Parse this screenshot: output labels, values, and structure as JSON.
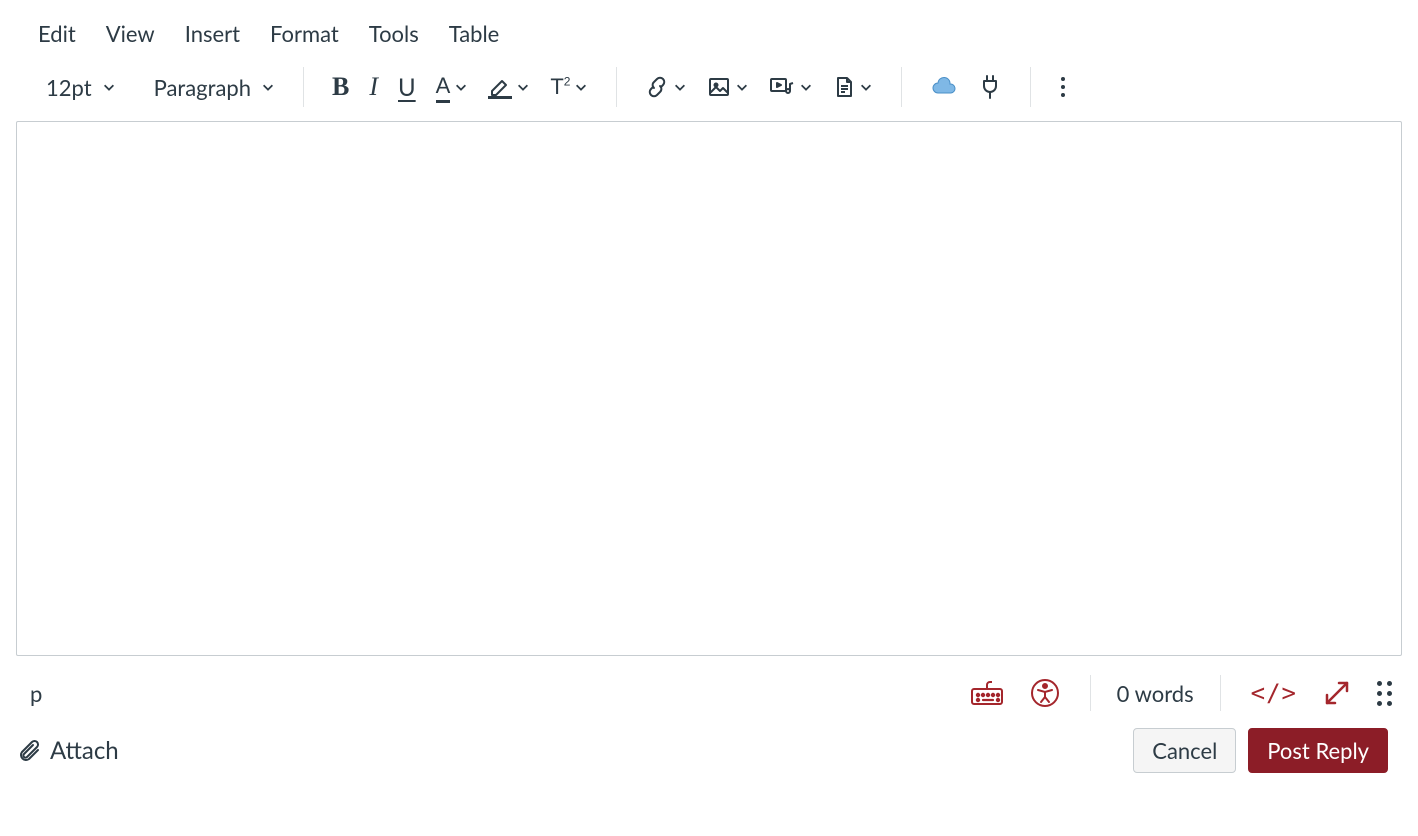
{
  "menu": {
    "edit": "Edit",
    "view": "View",
    "insert": "Insert",
    "format": "Format",
    "tools": "Tools",
    "table": "Table"
  },
  "toolbar": {
    "font_size": "12pt",
    "block_format": "Paragraph"
  },
  "status": {
    "element_path": "p",
    "word_count_label": "0 words",
    "html_view_label": "</>"
  },
  "actions": {
    "attach_label": "Attach",
    "cancel_label": "Cancel",
    "post_reply_label": "Post Reply"
  },
  "colors": {
    "accent_red": "#a4262c",
    "brand_red": "#8c1d27"
  }
}
